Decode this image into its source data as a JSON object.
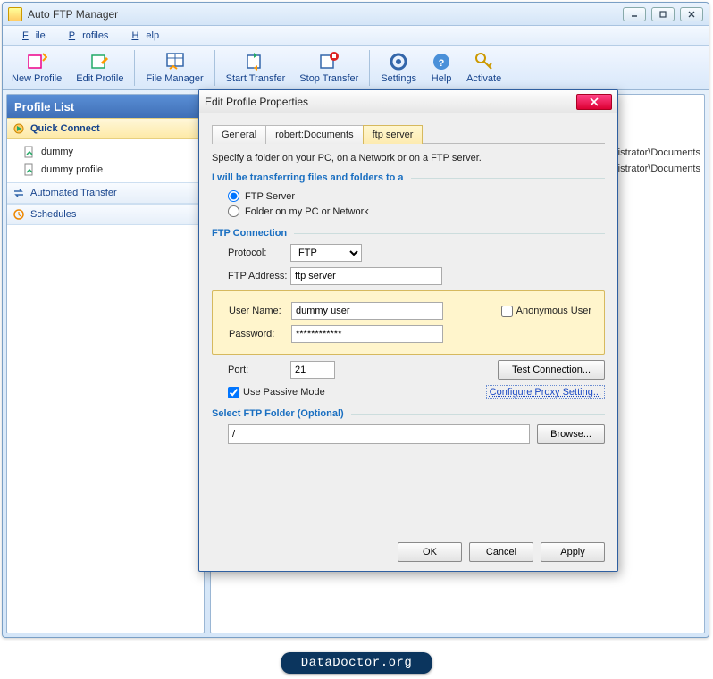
{
  "window": {
    "title": "Auto FTP Manager"
  },
  "menu": {
    "file": "File",
    "profiles": "Profiles",
    "help": "Help"
  },
  "toolbar": {
    "newProfile": "New Profile",
    "editProfile": "Edit Profile",
    "fileManager": "File Manager",
    "startTransfer": "Start Transfer",
    "stopTransfer": "Stop Transfer",
    "settings": "Settings",
    "help": "Help",
    "activate": "Activate"
  },
  "sidebar": {
    "header": "Profile List",
    "quickConnect": "Quick Connect",
    "items": [
      "dummy",
      "dummy profile"
    ],
    "automated": "Automated Transfer",
    "schedules": "Schedules"
  },
  "mainPanel": {
    "bgRow1": "ninistrator\\Documents",
    "bgRow2": "ninistrator\\Documents"
  },
  "dialog": {
    "title": "Edit Profile Properties",
    "tabs": {
      "general": "General",
      "robert": "robert:Documents",
      "ftp": "ftp server"
    },
    "intro": "Specify a folder on your PC, on a Network or on a  FTP server.",
    "section1": "I will be transferring files and folders to a",
    "radio1": "FTP Server",
    "radio2": "Folder on my PC or Network",
    "section2": "FTP Connection",
    "protocolLabel": "Protocol:",
    "protocolValue": "FTP",
    "addressLabel": "FTP Address:",
    "addressValue": "ftp server",
    "userLabel": "User Name:",
    "userValue": "dummy user",
    "passLabel": "Password:",
    "passValue": "************",
    "anonLabel": "Anonymous User",
    "portLabel": "Port:",
    "portValue": "21",
    "testBtn": "Test Connection...",
    "passiveLabel": "Use Passive Mode",
    "proxyLink": "Configure Proxy Setting...",
    "section3": "Select FTP Folder (Optional)",
    "folderValue": "/",
    "browseBtn": "Browse...",
    "ok": "OK",
    "cancel": "Cancel",
    "apply": "Apply"
  },
  "footer": "DataDoctor.org"
}
